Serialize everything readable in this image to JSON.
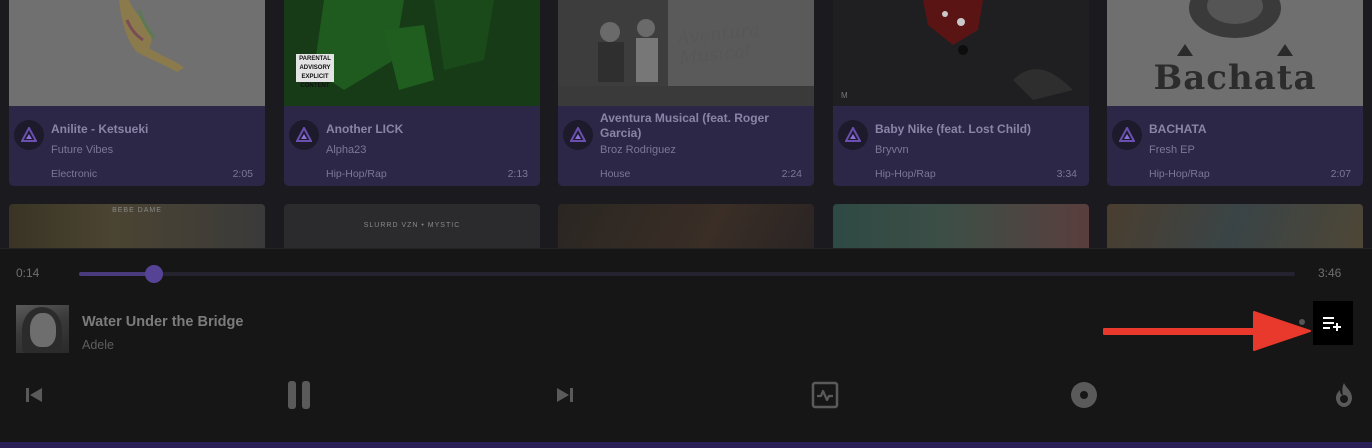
{
  "grid": {
    "cards": [
      {
        "title": "Anilite - Ketsueki",
        "artist": "Future Vibes",
        "genre": "Electronic",
        "duration": "2:05"
      },
      {
        "title": "Another LICK",
        "artist": "Alpha23",
        "genre": "Hip-Hop/Rap",
        "duration": "2:13"
      },
      {
        "title": "Aventura Musical (feat. Roger Garcia)",
        "artist": "Broz Rodriguez",
        "genre": "House",
        "duration": "2:24"
      },
      {
        "title": "Baby Nike (feat. Lost Child)",
        "artist": "Bryvvn",
        "genre": "Hip-Hop/Rap",
        "duration": "3:34"
      },
      {
        "title": "BACHATA",
        "artist": "Fresh EP",
        "genre": "Hip-Hop/Rap",
        "duration": "2:07"
      }
    ],
    "art_text": {
      "bachata": "Bachata",
      "aventura": "Aventura Musical",
      "parental": "PARENTAL ADVISORY EXPLICIT CONTENT",
      "badge_m": "M",
      "row2_bebe": "BEBE DAME",
      "row2_mystic": "SLURRD VZN  •  MYSTIC"
    }
  },
  "player": {
    "elapsed": "0:14",
    "total": "3:46",
    "progress_fraction": 0.062,
    "now_playing": {
      "title": "Water Under the Bridge",
      "artist": "Adele"
    }
  },
  "icons": {
    "queue": "playlist-add-icon",
    "prev": "skip-previous-icon",
    "pause": "pause-icon",
    "next": "skip-next-icon",
    "activity": "activity-pulse-icon",
    "disc": "disc-icon",
    "flame": "flame-icon"
  },
  "colors": {
    "accent": "#574396",
    "card_info_bg": "#2d2747",
    "annotation_arrow": "#e8392c"
  }
}
